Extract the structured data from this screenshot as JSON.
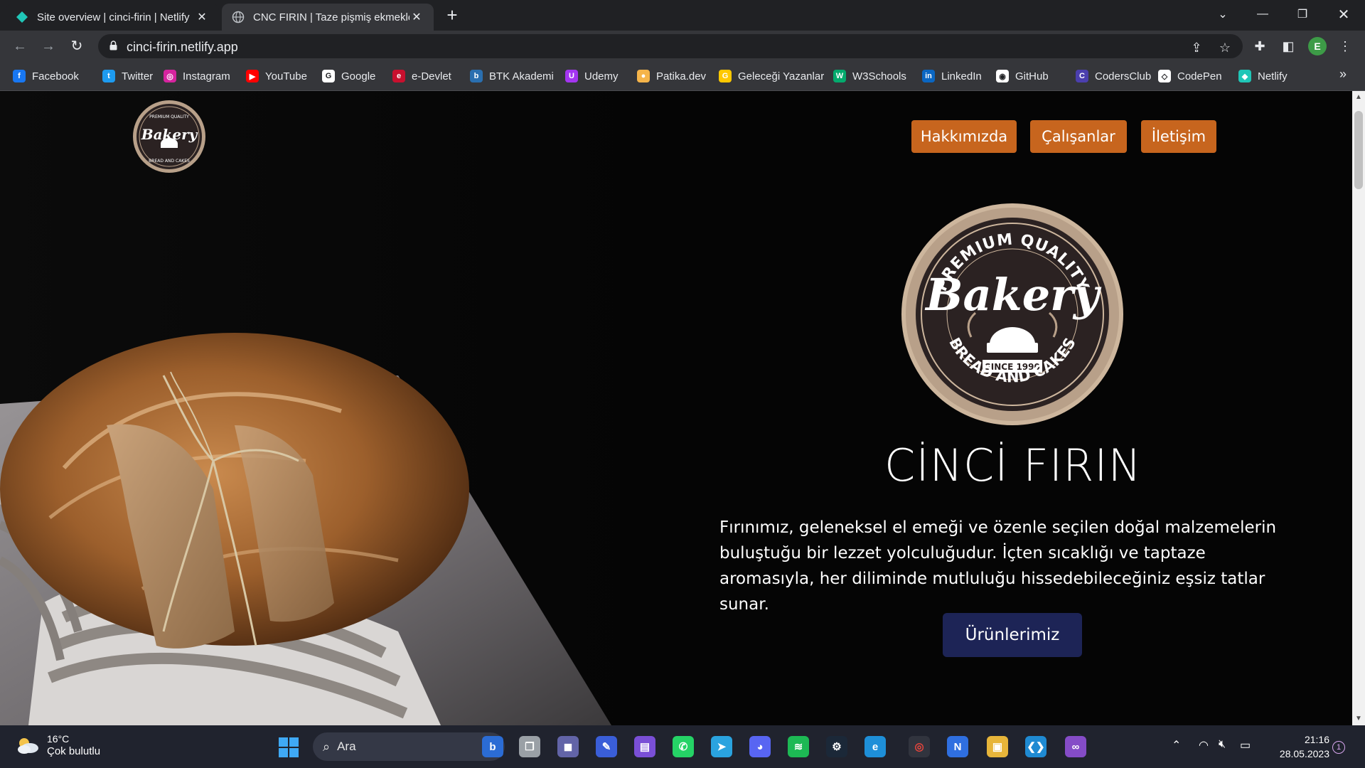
{
  "browser": {
    "tabs": [
      {
        "title": "Site overview | cinci-firin | Netlify",
        "icon": "netlify-icon",
        "active": false
      },
      {
        "title": "CNC FIRIN | Taze pişmiş ekmekler",
        "icon": "globe-icon",
        "active": true
      }
    ],
    "url": "cinci-firin.netlify.app",
    "profile_initial": "E",
    "bookmarks": [
      {
        "label": "Facebook",
        "icon": "facebook-icon",
        "color": "#1877f2",
        "glyph": "f"
      },
      {
        "label": "Twitter",
        "icon": "twitter-icon",
        "color": "#1d9bf0",
        "glyph": "t"
      },
      {
        "label": "Instagram",
        "icon": "instagram-icon",
        "color": "#d6249f",
        "glyph": "◎"
      },
      {
        "label": "YouTube",
        "icon": "youtube-icon",
        "color": "#ff0000",
        "glyph": "▶"
      },
      {
        "label": "Google",
        "icon": "google-icon",
        "color": "#ffffff",
        "glyph": "G"
      },
      {
        "label": "e-Devlet",
        "icon": "edevlet-icon",
        "color": "#c8102e",
        "glyph": "e"
      },
      {
        "label": "BTK Akademi",
        "icon": "btk-icon",
        "color": "#2a6fb0",
        "glyph": "b"
      },
      {
        "label": "Udemy",
        "icon": "udemy-icon",
        "color": "#a435f0",
        "glyph": "U"
      },
      {
        "label": "Patika.dev",
        "icon": "patika-icon",
        "color": "#f5b44a",
        "glyph": "●"
      },
      {
        "label": "Geleceği Yazanlar",
        "icon": "gelecegi-yazanlar-icon",
        "color": "#ffc800",
        "glyph": "G"
      },
      {
        "label": "W3Schools",
        "icon": "w3schools-icon",
        "color": "#04aa6d",
        "glyph": "W"
      },
      {
        "label": "LinkedIn",
        "icon": "linkedin-icon",
        "color": "#0a66c2",
        "glyph": "in"
      },
      {
        "label": "GitHub",
        "icon": "github-icon",
        "color": "#ffffff",
        "glyph": "◉"
      },
      {
        "label": "CodersClub",
        "icon": "codersclub-icon",
        "color": "#4b3fae",
        "glyph": "C"
      },
      {
        "label": "CodePen",
        "icon": "codepen-icon",
        "color": "#ffffff",
        "glyph": "◇"
      },
      {
        "label": "Netlify",
        "icon": "netlify-icon",
        "color": "#20c6b7",
        "glyph": "◆"
      }
    ]
  },
  "site": {
    "logo_small": {
      "top": "PREMIUM QUALITY",
      "main": "Bakery",
      "bottom": "BREAD AND CAKES"
    },
    "nav": [
      "Hakkımızda",
      "Çalışanlar",
      "İletişim"
    ],
    "logo_large": {
      "top": "PREMIUM QUALITY",
      "main": "Bakery",
      "since": "SINCE 1990",
      "bottom": "BREAD AND CAKES"
    },
    "title": "CİNCİ FIRIN",
    "intro": "Fırınımız, geleneksel el emeği ve özenle seçilen doğal malzemelerin buluştuğu bir lezzet yolculuğudur. İçten sıcaklığı ve taptaze aromasıyla, her diliminde mutluluğu hissedebileceğiniz eşsiz tatlar sunar.",
    "cta": "Ürünlerimiz",
    "colors": {
      "nav_button": "#c7651e",
      "cta_button": "#1d2456",
      "logo_ring": "#b8a089",
      "logo_center": "#2b2222"
    }
  },
  "taskbar": {
    "weather_temp": "16°C",
    "weather_desc": "Çok bulutlu",
    "search_placeholder": "Ara",
    "time": "21:16",
    "date": "28.05.2023",
    "notification_count": "1",
    "apps": [
      {
        "name": "bing-icon",
        "color": "#2b6cd4",
        "glyph": "b"
      },
      {
        "name": "task-view-icon",
        "color": "#9aa0a6",
        "glyph": "❐"
      },
      {
        "name": "teams-chat-icon",
        "color": "#6264a7",
        "glyph": "◼"
      },
      {
        "name": "pen-app-icon",
        "color": "#3a5ed8",
        "glyph": "✎"
      },
      {
        "name": "clipchamp-icon",
        "color": "#7a4fd6",
        "glyph": "▤"
      },
      {
        "name": "whatsapp-icon",
        "color": "#25d366",
        "glyph": "✆"
      },
      {
        "name": "telegram-icon",
        "color": "#2aa3df",
        "glyph": "➤"
      },
      {
        "name": "discord-icon",
        "color": "#5865f2",
        "glyph": "◕"
      },
      {
        "name": "spotify-icon",
        "color": "#1db954",
        "glyph": "≋"
      },
      {
        "name": "steam-icon",
        "color": "#1b2838",
        "glyph": "⚙"
      },
      {
        "name": "edge-icon",
        "color": "#1e8fd8",
        "glyph": "e"
      },
      {
        "name": "chrome-icon",
        "color": "#e8453c",
        "glyph": "◎"
      },
      {
        "name": "notion-icon",
        "color": "#2f6fe0",
        "glyph": "N"
      },
      {
        "name": "explorer-icon",
        "color": "#e7b53a",
        "glyph": "▣"
      },
      {
        "name": "vscode-icon",
        "color": "#1f8ad2",
        "glyph": "❮❯"
      },
      {
        "name": "visual-studio-icon",
        "color": "#854cc7",
        "glyph": "∞"
      }
    ]
  }
}
